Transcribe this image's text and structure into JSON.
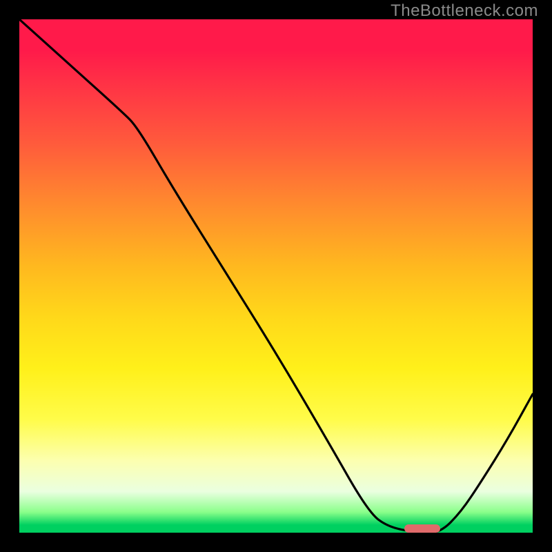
{
  "watermark": "TheBottleneck.com",
  "chart_data": {
    "type": "line",
    "title": "",
    "xlabel": "",
    "ylabel": "",
    "xlim": [
      0,
      100
    ],
    "ylim": [
      0,
      100
    ],
    "x": [
      0,
      10,
      20,
      23,
      30,
      40,
      50,
      60,
      68,
      72,
      78,
      82,
      86,
      90,
      95,
      100
    ],
    "values": [
      100,
      91,
      82,
      79,
      67,
      51,
      35,
      18,
      4,
      1,
      0,
      0,
      4,
      10,
      18,
      27
    ],
    "optimum_marker": {
      "x_start": 75,
      "x_end": 82,
      "y": 0.8
    },
    "gradient_stops": [
      {
        "pos": 0,
        "color": "#ff1a4a"
      },
      {
        "pos": 24,
        "color": "#ff5a3c"
      },
      {
        "pos": 48,
        "color": "#ffb81f"
      },
      {
        "pos": 68,
        "color": "#fff01a"
      },
      {
        "pos": 86,
        "color": "#fcffb0"
      },
      {
        "pos": 96,
        "color": "#8aff8a"
      },
      {
        "pos": 100,
        "color": "#00d060"
      }
    ]
  }
}
